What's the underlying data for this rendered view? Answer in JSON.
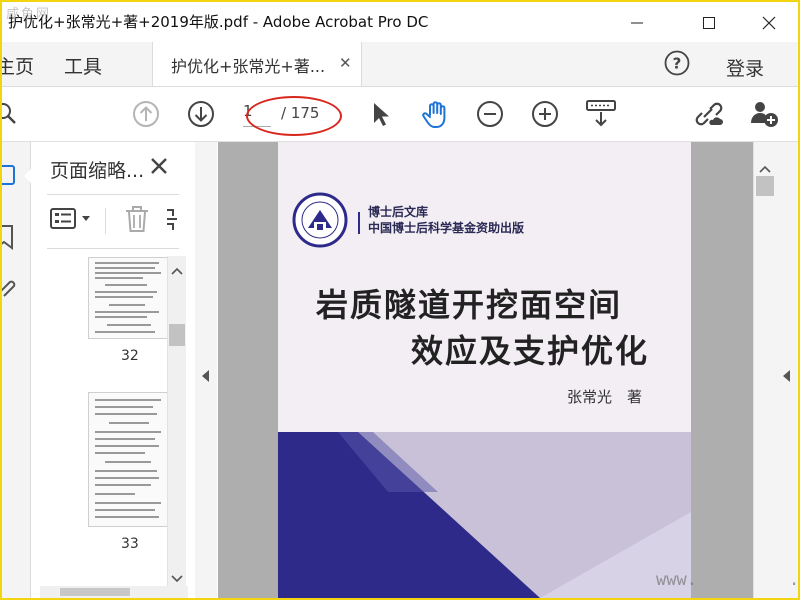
{
  "window": {
    "title": "护优化+张常光+著+2019年版.pdf - Adobe Acrobat Pro DC",
    "watermark_top": "咸鱼网",
    "watermark_bottom": "www.         .com"
  },
  "tabs": {
    "home": "主页",
    "tools": "工具",
    "document": "护优化+张常光+著...",
    "help_icon": "question-icon",
    "login": "登录"
  },
  "toolbar": {
    "current_page": "1",
    "total_pages": "/ 175",
    "annotation_color": "#d9261c"
  },
  "thumbnails": {
    "header": "页面缩略...",
    "items": [
      {
        "page": "32"
      },
      {
        "page": "33"
      }
    ]
  },
  "cover": {
    "series_line1": "博士后文库",
    "series_line2": "中国博士后科学基金资助出版",
    "title_line1": "岩质隧道开挖面空间",
    "title_line2": "效应及支护优化",
    "author": "张常光　著",
    "accent_color": "#2d2a8a"
  }
}
